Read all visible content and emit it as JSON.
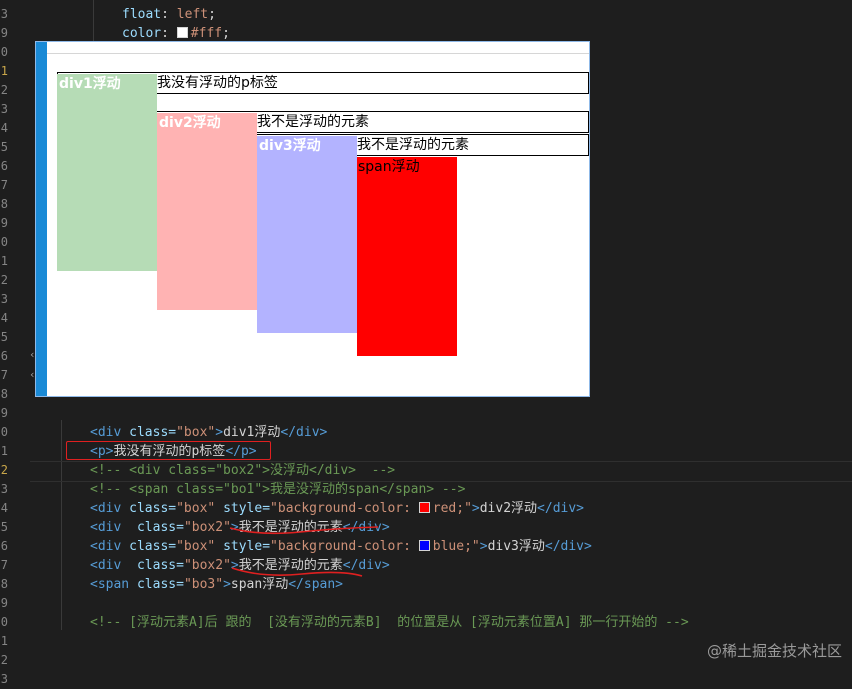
{
  "editor": {
    "top_lines": [
      {
        "prop": "float",
        "value": "left"
      },
      {
        "prop": "color",
        "value": "#fff",
        "swatch": "#ffffff"
      }
    ],
    "gutter_numbers": [
      "3",
      "9",
      "0",
      "1",
      "2",
      "3",
      "4",
      "5",
      "6",
      "7",
      "8",
      "9",
      "0",
      "1",
      "2",
      "3",
      "4",
      "5",
      "6",
      "7",
      "8",
      "9",
      "0",
      "1",
      "2",
      "3",
      "4",
      "5",
      "6",
      "7",
      "8",
      "9",
      "0",
      "1",
      "2",
      "3"
    ],
    "code_lines": [
      {
        "tag_open": "<div",
        "attr": "class=",
        "str": "\"box\"",
        "close": ">",
        "text": "div1浮动",
        "tag_end": "</div>"
      },
      {
        "tag_open": "<p>",
        "text": "我没有浮动的p标签",
        "tag_end": "</p>"
      },
      {
        "comment": "<!-- <div class=\"box2\">没浮动</div>  -->"
      },
      {
        "comment": "<!-- <span class=\"bo1\">我是没浮动的span</span> -->"
      },
      {
        "tag_open": "<div",
        "attr": "class=",
        "str": "\"box\"",
        "attr2": "style=",
        "str2a": "\"background-color: ",
        "swatch": "#ff0000",
        "str2b": "red;\"",
        "close": ">",
        "text": "div2浮动",
        "tag_end": "</div>"
      },
      {
        "tag_open": "<div",
        "attr": " class=",
        "str": "\"box2\"",
        "close": ">",
        "text": "我不是浮动的元素",
        "tag_end": "</div>"
      },
      {
        "tag_open": "<div",
        "attr": "class=",
        "str": "\"box\"",
        "attr2": "style=",
        "str2a": "\"background-color: ",
        "swatch": "#0000ff",
        "str2b": "blue;\"",
        "close": ">",
        "text": "div3浮动",
        "tag_end": "</div>"
      },
      {
        "tag_open": "<div",
        "attr": " class=",
        "str": "\"box2\"",
        "close": ">",
        "text": "我不是浮动的元素",
        "tag_end": "</div>"
      },
      {
        "tag_open": "<span",
        "attr": "class=",
        "str": "\"bo3\"",
        "close": ">",
        "text": "span浮动",
        "tag_end": "</span>"
      },
      {
        "blank": true
      },
      {
        "comment": "<!-- [浮动元素A]后 跟的  [没有浮动的元素B]  的位置是从 [浮动元素位置A] 那一行开始的 -->"
      }
    ]
  },
  "preview": {
    "div1_label": "div1浮动",
    "p_text": "我没有浮动的p标签",
    "div2_label": "div2浮动",
    "nonfloat1_text": "我不是浮动的元素",
    "div3_label": "div3浮动",
    "nonfloat2_text": "我不是浮动的元素",
    "span_label": "span浮动",
    "colors": {
      "div1": "#b6dcb6",
      "div2": "#ffb3b3",
      "div3": "#b3b3ff",
      "span": "#ff0000"
    }
  },
  "watermark": "@稀土掘金技术社区",
  "annotation_color": "#e02020"
}
